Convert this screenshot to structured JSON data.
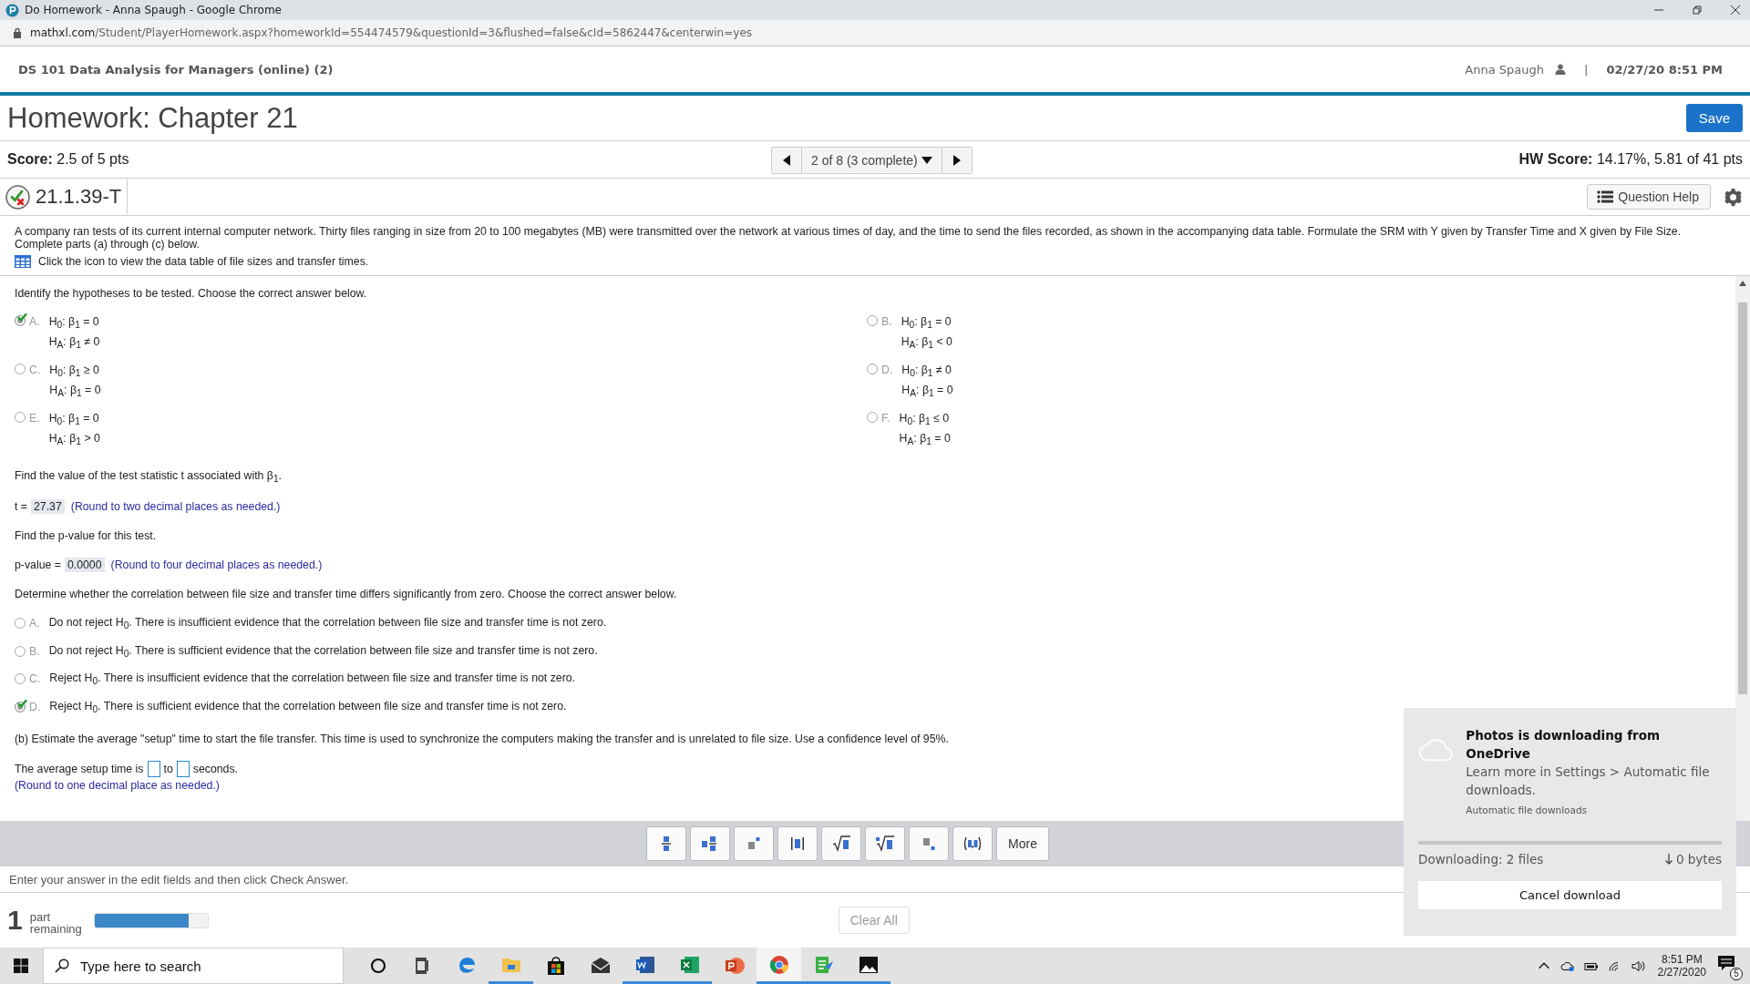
{
  "window": {
    "title": "Do Homework - Anna Spaugh - Google Chrome"
  },
  "address_bar": {
    "host": "mathxl.com",
    "path": "/Student/PlayerHomework.aspx?homeworkId=554474579&questionId=3&flushed=false&cId=5862447&centerwin=yes"
  },
  "header": {
    "course": "DS 101 Data Analysis for Managers (online) (2)",
    "user": "Anna Spaugh",
    "separator": "|",
    "datetime": "02/27/20 8:51 PM"
  },
  "homework": {
    "title": "Homework: Chapter 21",
    "save_button": "Save"
  },
  "score": {
    "label": "Score:",
    "value": "2.5 of 5 pts",
    "hw_label": "HW Score:",
    "hw_value": "14.17%, 5.81 of 41 pts"
  },
  "navigator": {
    "position": "2 of 8 (3 complete)"
  },
  "question": {
    "id": "21.1.39-T",
    "help_button": "Question Help",
    "intro": "A company ran tests of its current internal computer network. Thirty files ranging in size from 20 to 100 megabytes (MB) were transmitted over the network at various times of day, and the time to send the files recorded, as shown in the accompanying data table. Formulate the SRM with Y given by Transfer Time and X given by File Size. Complete parts (a) through (c) below.",
    "data_table_link": "Click the icon to view the data table of file sizes and transfer times."
  },
  "content": [
    {
      "kind": "prompt",
      "text": "Identify the hypotheses to be tested. Choose the correct answer below."
    },
    {
      "kind": "choice_grid",
      "choices": [
        {
          "letter": "A.",
          "lines": [
            "H$_{0}$: β$_{1}$ = 0",
            "H$_{A}$: β$_{1}$ ≠ 0"
          ],
          "selected": true
        },
        {
          "letter": "B.",
          "lines": [
            "H$_{0}$: β$_{1}$ = 0",
            "H$_{A}$: β$_{1}$ < 0"
          ],
          "selected": false
        },
        {
          "letter": "C.",
          "lines": [
            "H$_{0}$: β$_{1}$ ≥ 0",
            "H$_{A}$: β$_{1}$ = 0"
          ],
          "selected": false
        },
        {
          "letter": "D.",
          "lines": [
            "H$_{0}$: β$_{1}$ ≠ 0",
            "H$_{A}$: β$_{1}$ = 0"
          ],
          "selected": false
        },
        {
          "letter": "E.",
          "lines": [
            "H$_{0}$: β$_{1}$ = 0",
            "H$_{A}$: β$_{1}$ > 0"
          ],
          "selected": false
        },
        {
          "letter": "F.",
          "lines": [
            "H$_{0}$: β$_{1}$ ≤ 0",
            "H$_{A}$: β$_{1}$ = 0"
          ],
          "selected": false
        }
      ]
    },
    {
      "kind": "prompt",
      "text": "Find the value of the test statistic t associated with β$_{1}$."
    },
    {
      "kind": "answer",
      "label": "t =",
      "value": "27.37",
      "hint": "(Round to two decimal places as needed.)"
    },
    {
      "kind": "prompt",
      "text": "Find the p-value for this test."
    },
    {
      "kind": "answer",
      "label": "p-value =",
      "value": "0.0000",
      "hint": "(Round to four decimal places as needed.)"
    },
    {
      "kind": "prompt",
      "text": "Determine whether the correlation between file size and transfer time differs significantly from zero. Choose the correct answer below."
    },
    {
      "kind": "choice_list",
      "choices": [
        {
          "letter": "A.",
          "text": "Do not reject H$_{0}$. There is insufficient evidence that the correlation between file size and transfer time is not zero.",
          "selected": false
        },
        {
          "letter": "B.",
          "text": "Do not reject H$_{0}$. There is sufficient evidence that the correlation between file size and transfer time is not zero.",
          "selected": false
        },
        {
          "letter": "C.",
          "text": "Reject H$_{0}$. There is insufficient evidence that the correlation between file size and transfer time is not zero.",
          "selected": false
        },
        {
          "letter": "D.",
          "text": "Reject H$_{0}$. There is sufficient evidence that the correlation between file size and transfer time is not zero.",
          "selected": true
        }
      ]
    },
    {
      "kind": "prompt",
      "text": "(b) Estimate the average \"setup\" time to start the file transfer. This time is used to synchronize the computers making the transfer and is unrelated to file size. Use a confidence level of 95%."
    },
    {
      "kind": "interval",
      "before": "The average setup time is",
      "between": "to",
      "after": "seconds.",
      "hint": "(Round to one decimal place as needed.)"
    }
  ],
  "toolbar": [
    {
      "kind": "fraction"
    },
    {
      "kind": "mixed"
    },
    {
      "kind": "exponent"
    },
    {
      "kind": "abs"
    },
    {
      "kind": "sqrt"
    },
    {
      "kind": "root"
    },
    {
      "kind": "subscript"
    },
    {
      "kind": "pair"
    },
    {
      "kind": "text",
      "label": "More"
    }
  ],
  "footer": {
    "instruction": "Enter your answer in the edit fields and then click Check Answer.",
    "remaining_count": "1",
    "remaining_label": "part remaining",
    "level": 0.83,
    "clear_button": "Clear All"
  },
  "notification": {
    "title": "Photos is downloading from OneDrive",
    "body": "Learn more in Settings > Automatic file downloads.",
    "link": "Automatic file downloads",
    "status": "Downloading: 2 files",
    "size": "0 bytes",
    "button": "Cancel download"
  },
  "taskbar": {
    "search_placeholder": "Type here to search",
    "apps": [
      {
        "kind": "edge",
        "running": false,
        "selected": false
      },
      {
        "kind": "explorer",
        "running": true,
        "selected": false
      },
      {
        "kind": "store",
        "running": false,
        "selected": false
      },
      {
        "kind": "mail",
        "running": false,
        "selected": false
      },
      {
        "kind": "word",
        "running": true,
        "selected": false
      },
      {
        "kind": "excel",
        "running": true,
        "selected": false
      },
      {
        "kind": "powerpoint",
        "running": false,
        "selected": false
      },
      {
        "kind": "chrome",
        "running": true,
        "selected": true
      },
      {
        "kind": "notes",
        "running": true,
        "selected": false
      },
      {
        "kind": "photos",
        "running": true,
        "selected": false
      }
    ],
    "time": "8:51 PM",
    "date": "2/27/2020",
    "notifications": "5"
  }
}
